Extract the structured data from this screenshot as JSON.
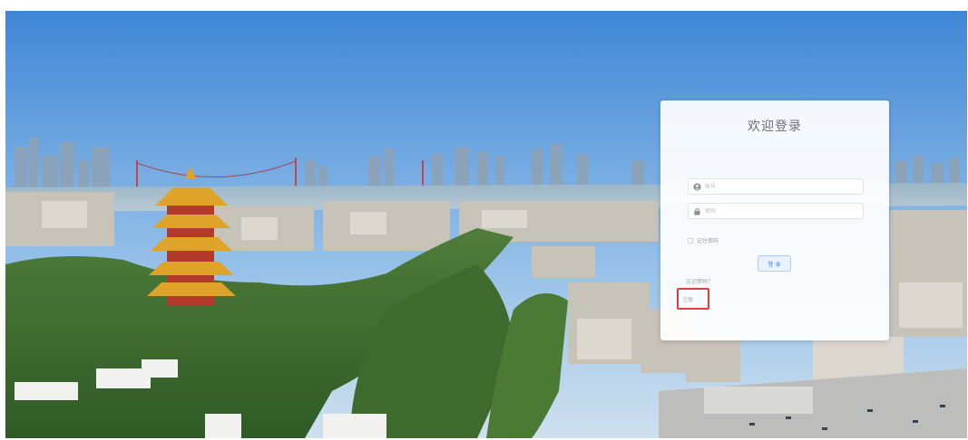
{
  "login": {
    "title": "欢迎登录",
    "username_placeholder": "账号",
    "password_placeholder": "密码",
    "remember_label": "记住密码",
    "login_button": "登 录",
    "forgot_label": "忘记密码？",
    "register_link": "注册"
  },
  "icons": {
    "username": "user-icon",
    "password": "lock-icon"
  },
  "colors": {
    "accent": "#3d8ee8",
    "highlight_box": "#e23d3d"
  }
}
